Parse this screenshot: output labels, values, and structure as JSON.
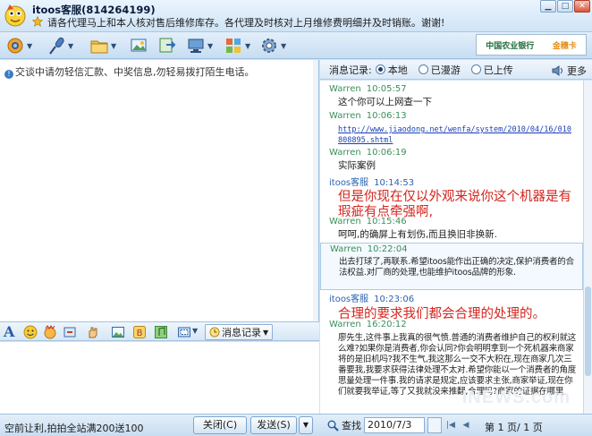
{
  "window": {
    "title": "itoos客服(814264199)",
    "notice": "请各代理马上和本人核对售后维修库存。各代理及时核对上月维修费明细并及时销账。谢谢!"
  },
  "toolbar": {
    "items": [
      "video-camera",
      "microphone",
      "send-file",
      "screenshot-send",
      "transfer",
      "remote-assist",
      "settings"
    ]
  },
  "bank": {
    "name": "中国农业银行",
    "card": "金穗卡"
  },
  "chat": {
    "warning": "交谈中请勿轻信汇款、中奖信息,勿轻易拨打陌生电话。"
  },
  "format_bar": {
    "font_label": "A",
    "history_button": "消息记录"
  },
  "history": {
    "label": "消息记录:",
    "options": [
      "本地",
      "已漫游",
      "已上传"
    ],
    "selected": "本地",
    "more": "更多",
    "messages": [
      {
        "sender": "Warren",
        "time": "10:05:57",
        "text": "这个你可以上网查一下"
      },
      {
        "sender": "Warren",
        "time": "10:06:13",
        "text": "http://www.jiaodong.net/wenfa/system/2010/04/16/010808895.shtml"
      },
      {
        "sender": "Warren",
        "time": "10:06:19",
        "text": "实际案例"
      },
      {
        "sender": "itoos客服",
        "time": "10:14:53",
        "text": "但是你现在仅以外观来说你这个机器是有瑕疵有点牵强啊,"
      },
      {
        "sender": "Warren",
        "time": "10:15:46",
        "text": "呵呵,的确屏上有划伤,而且换旧非换新."
      },
      {
        "sender": "Warren",
        "time": "10:22:04",
        "text": "出去打球了,再联系.希望itoos能作出正确的决定,保护消费者的合法权益.对厂商的处理,也能维护itoos品牌的形象."
      },
      {
        "sender": "itoos客服",
        "time": "10:23:06",
        "text": "合理的要求我们都会合理的处理的。"
      },
      {
        "sender": "Warren",
        "time": "16:20:12",
        "text": "廖先生,这件事上我真的很气愤.普通的消费者维护自己的权利就这么难?如果你是消费者,你会认同?你会明明拿到一个死机器来商家将的是旧机吗?我不生气,我这那么一交不大积在,现在商家几次三番要我,我要求获得法律处理不太对.希望你能以一个消费者的角度思量处理一件事.我的请求是规定,应该要求主张,商家举证,现在你们就要我举证,等了又我就没来推翻,合理吗?商家的证据在哪里"
      }
    ]
  },
  "bottom": {
    "promo": "空前让利,拍拍全站满200送100",
    "close_label": "关闭(C)",
    "send_label": "发送(S)",
    "search_label": "查找",
    "date": "2010/7/3",
    "page": "第 1 页/ 1 页",
    "watermark": "INEWS.com"
  }
}
